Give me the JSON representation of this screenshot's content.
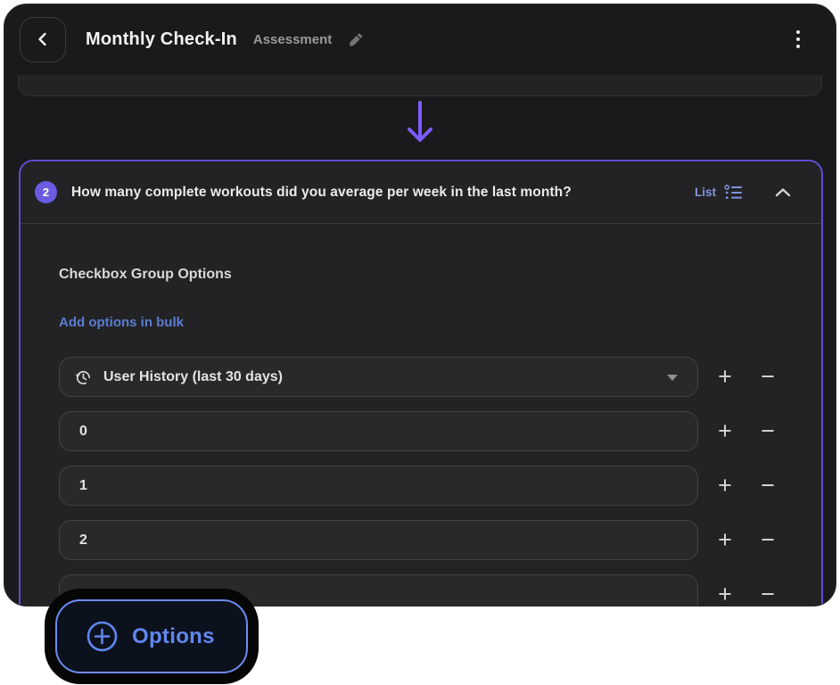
{
  "header": {
    "title": "Monthly Check-In",
    "subtitle": "Assessment",
    "back_icon": "chevron-left",
    "edit_icon": "pencil",
    "menu_icon": "kebab-menu"
  },
  "flow": {
    "connector_icon": "arrow-down"
  },
  "question_card": {
    "number": "2",
    "question": "How many complete workouts did you average per week in the last month?",
    "type_label": "List",
    "type_icon": "list-bullets",
    "collapse_icon": "chevron-up",
    "section_title": "Checkbox Group Options",
    "bulk_link": "Add options in bulk",
    "options": [
      {
        "value": "User History (last 30 days)",
        "leading_icon": "history-clock",
        "trailing_icon": "caret-down"
      },
      {
        "value": "0"
      },
      {
        "value": "1"
      },
      {
        "value": "2"
      },
      {
        "value": ""
      }
    ],
    "stepper": {
      "add_label": "+",
      "remove_label": "−"
    }
  },
  "options_button": {
    "label": "Options",
    "icon": "circle-plus"
  },
  "colors": {
    "app_bg": "#1a1a1c",
    "card_bg": "#232326",
    "card_border": "#5c4ecf",
    "badge_purple": "#6a5be2",
    "arrow_purple": "#7c5efc",
    "list_label_blue": "#8595da",
    "bulk_link_blue": "#5b7cd1",
    "options_blue": "#6087ec",
    "input_bg": "#29292c",
    "input_border": "#424245"
  }
}
